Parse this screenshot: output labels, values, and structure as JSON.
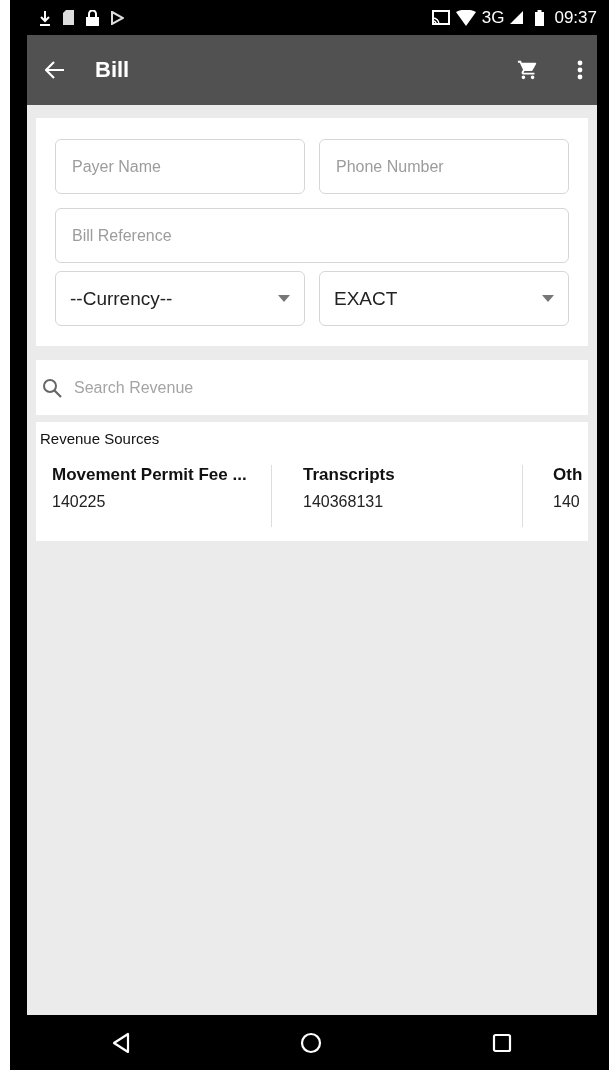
{
  "status_bar": {
    "network": "3G",
    "time": "09:37"
  },
  "app_bar": {
    "title": "Bill"
  },
  "form": {
    "fields": [
      {
        "placeholder": "Payer Name"
      },
      {
        "placeholder": "Phone Number"
      },
      {
        "placeholder": "Bill Reference",
        "wide": true
      }
    ],
    "selects": [
      {
        "value": "--Currency--"
      },
      {
        "value": "EXACT"
      }
    ]
  },
  "search": {
    "placeholder": "Search Revenue"
  },
  "revenue_sources": {
    "heading": "Revenue Sources",
    "items": [
      {
        "name": "Movement Permit Fee ...",
        "code": "140225"
      },
      {
        "name": "Transcripts",
        "code": "140368131"
      },
      {
        "name": "Oth",
        "code": "140"
      }
    ]
  }
}
